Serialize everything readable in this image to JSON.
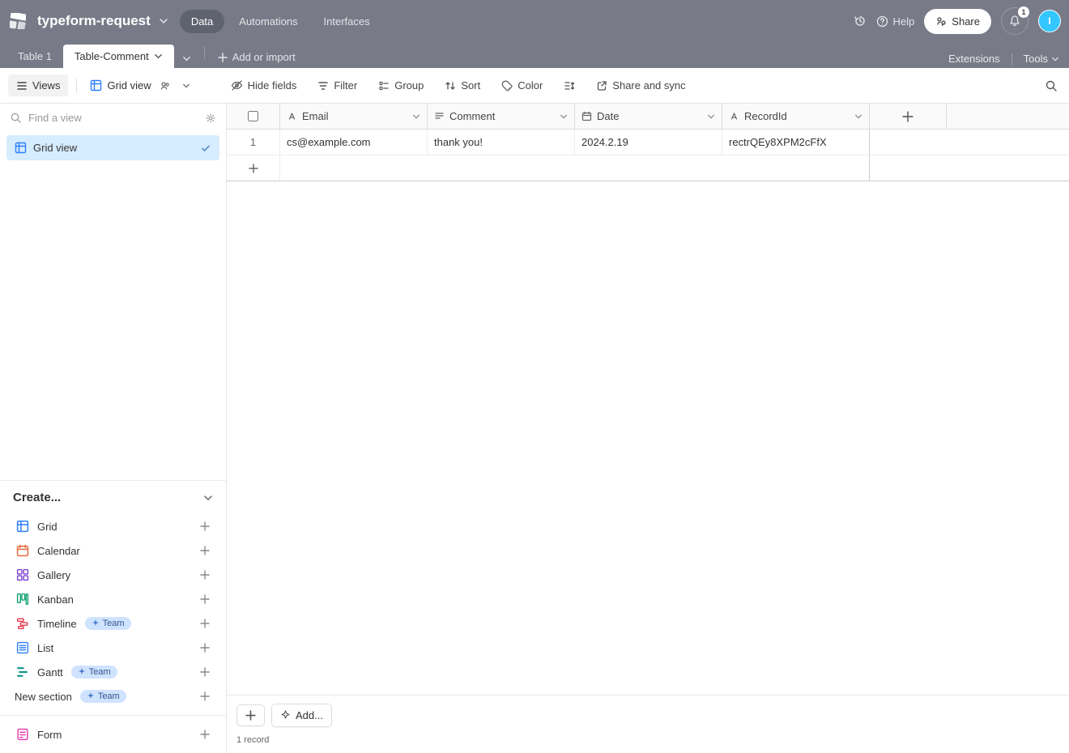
{
  "topbar": {
    "base_name": "typeform-request",
    "nav": {
      "data": "Data",
      "automations": "Automations",
      "interfaces": "Interfaces"
    },
    "help_label": "Help",
    "share_label": "Share",
    "notification_count": "1",
    "avatar_initial": "I"
  },
  "tabs": {
    "table1": "Table 1",
    "table_comment": "Table-Comment",
    "add_or_import": "Add or import",
    "extensions": "Extensions",
    "tools": "Tools"
  },
  "toolbar": {
    "views": "Views",
    "grid_view": "Grid view",
    "hide_fields": "Hide fields",
    "filter": "Filter",
    "group": "Group",
    "sort": "Sort",
    "color": "Color",
    "share_and_sync": "Share and sync"
  },
  "sidebar": {
    "find_placeholder": "Find a view",
    "grid_view_item": "Grid view",
    "create_label": "Create...",
    "items": {
      "grid": "Grid",
      "calendar": "Calendar",
      "gallery": "Gallery",
      "kanban": "Kanban",
      "timeline": "Timeline",
      "list": "List",
      "gantt": "Gantt",
      "new_section": "New section",
      "form": "Form"
    },
    "team_badge": "Team"
  },
  "grid": {
    "columns": {
      "email": "Email",
      "comment": "Comment",
      "date": "Date",
      "recordid": "RecordId"
    },
    "rows": [
      {
        "num": "1",
        "email": "cs@example.com",
        "comment": "thank you!",
        "date": "2024.2.19",
        "recordid": "rectrQEy8XPM2cFfX"
      }
    ],
    "footer": {
      "add_label": "Add...",
      "record_count": "1 record"
    }
  }
}
